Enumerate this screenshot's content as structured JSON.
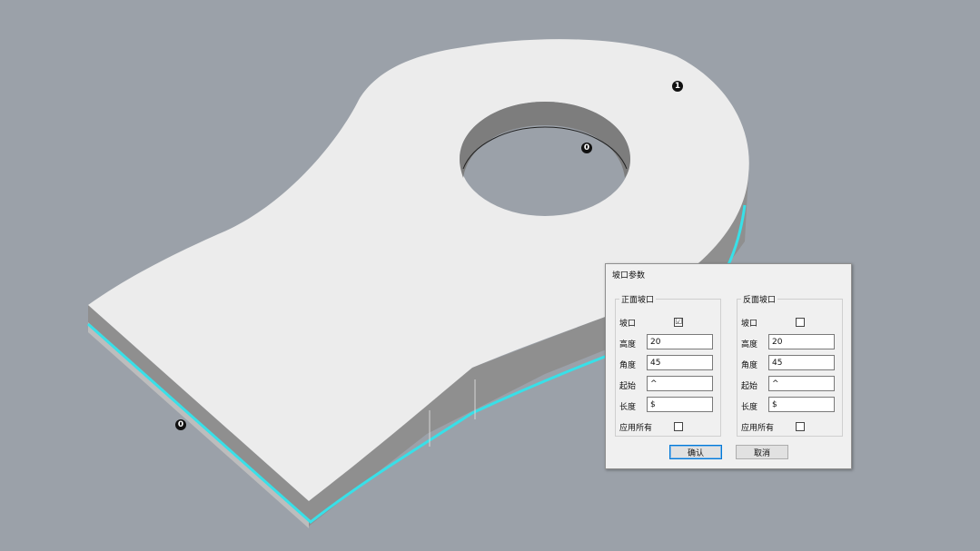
{
  "viewport": {
    "markers": [
      "1",
      "0",
      "0"
    ],
    "colors": {
      "background": "#9ba1a9",
      "part_top": "#ececec",
      "part_side": "#8f8f8f",
      "highlight_edge": "#38e0e8"
    }
  },
  "dialog": {
    "title": "坡口参数",
    "front": {
      "title": "正面坡口",
      "bevel_label": "坡口",
      "bevel_checked": "☑",
      "height_label": "高度",
      "height_value": "20",
      "angle_label": "角度",
      "angle_value": "45",
      "start_label": "起始",
      "start_value": "^",
      "length_label": "长度",
      "length_value": "$",
      "apply_all_label": "应用所有",
      "apply_all_checked": ""
    },
    "back": {
      "title": "反面坡口",
      "bevel_label": "坡口",
      "bevel_checked": "",
      "height_label": "高度",
      "height_value": "20",
      "angle_label": "角度",
      "angle_value": "45",
      "start_label": "起始",
      "start_value": "^",
      "length_label": "长度",
      "length_value": "$",
      "apply_all_label": "应用所有",
      "apply_all_checked": ""
    },
    "ok_label": "确认",
    "cancel_label": "取消"
  }
}
